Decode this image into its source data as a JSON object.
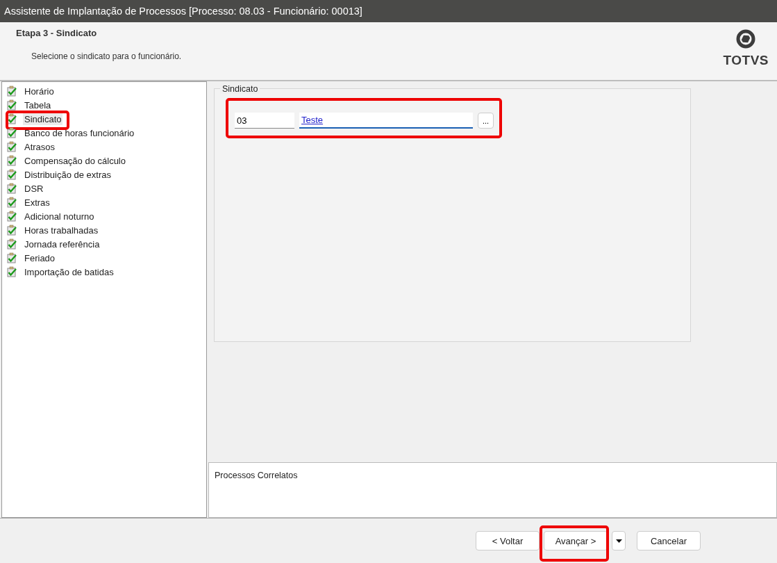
{
  "window": {
    "title": "Assistente de Implantação de Processos [Processo: 08.03 - Funcionário: 00013]"
  },
  "header": {
    "step_title": "Etapa 3 - Sindicato",
    "instruction": "Selecione o sindicato para o funcionário.",
    "logo_text": "TOTVS"
  },
  "steps": [
    {
      "label": "Horário",
      "completed": true,
      "selected": false,
      "highlighted": false
    },
    {
      "label": "Tabela",
      "completed": true,
      "selected": false,
      "highlighted": false
    },
    {
      "label": "Sindicato",
      "completed": true,
      "selected": true,
      "highlighted": true
    },
    {
      "label": "Banco de horas funcionário",
      "completed": true,
      "selected": false,
      "highlighted": false
    },
    {
      "label": "Atrasos",
      "completed": true,
      "selected": false,
      "highlighted": false
    },
    {
      "label": "Compensação do cálculo",
      "completed": true,
      "selected": false,
      "highlighted": false
    },
    {
      "label": "Distribuição de extras",
      "completed": true,
      "selected": false,
      "highlighted": false
    },
    {
      "label": "DSR",
      "completed": true,
      "selected": false,
      "highlighted": false
    },
    {
      "label": "Extras",
      "completed": true,
      "selected": false,
      "highlighted": false
    },
    {
      "label": "Adicional noturno",
      "completed": true,
      "selected": false,
      "highlighted": false
    },
    {
      "label": "Horas trabalhadas",
      "completed": true,
      "selected": false,
      "highlighted": false
    },
    {
      "label": "Jornada referência",
      "completed": true,
      "selected": false,
      "highlighted": false
    },
    {
      "label": "Feriado",
      "completed": true,
      "selected": false,
      "highlighted": false
    },
    {
      "label": "Importação de batidas",
      "completed": true,
      "selected": false,
      "highlighted": false
    }
  ],
  "group": {
    "legend": "Sindicato",
    "code": "03",
    "name": "Teste",
    "lookup_button": "...",
    "highlighted": true
  },
  "related": {
    "title": "Processos Correlatos"
  },
  "buttons": [
    {
      "label": "< Voltar",
      "kind": "button",
      "highlighted": false
    },
    {
      "label": "Avançar >",
      "kind": "button",
      "highlighted": true
    },
    {
      "kind": "dropdown",
      "highlighted": false
    },
    {
      "label": "Cancelar",
      "kind": "button",
      "highlighted": false
    }
  ]
}
